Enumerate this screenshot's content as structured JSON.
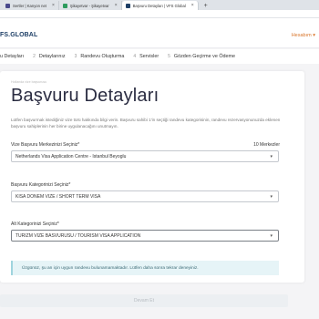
{
  "browser": {
    "tabs": [
      {
        "label": "Sertler | Kanyon net",
        "favicon_color": "#4a4a8c",
        "active": false
      },
      {
        "label": "Şikayetvar - Şikayetvar",
        "favicon_color": "#2e9b5e",
        "active": false
      },
      {
        "label": "Başvuru Detayları | VFS Global",
        "favicon_color": "#1e3f66",
        "active": true
      }
    ],
    "new_tab": "+"
  },
  "header": {
    "logo": "FS.GLOBAL",
    "user_menu": "Hesabım ▾"
  },
  "stepper": [
    {
      "num": "",
      "label": "u Detayları"
    },
    {
      "num": "2",
      "label": "Detaylarınız"
    },
    {
      "num": "3",
      "label": "Randevu Oluşturma"
    },
    {
      "num": "4",
      "label": "Servisler"
    },
    {
      "num": "5",
      "label": "Gözden Geçirme ve Ödeme"
    }
  ],
  "card": {
    "breadcrumb": "Hollanda vize başvurusu",
    "title": "Başvuru Detayları",
    "description": "Lütfen başvurmak istediğiniz vize türü hakkında bilgi verin. Başvuru sahibi 1'in seçtiği randevu kategorisinin, randevu rezervasyonunuzda eklenen başvuru sahiplerinin her birine uygulanacağını unutmayın.",
    "centre_label": "Vize Başvuru Merkezinizi Seçiniz*",
    "centre_count": "10 Merkezler",
    "centre_value": "Netherlands Visa Application Centre - Istanbul Beyoglu",
    "category_label": "Başvuru Kategorinizi Seçiniz*",
    "category_value": "KISA DONEM VIZE / SHORT TERM VISA",
    "subcategory_label": "Alt Kategorinizi Seçiniz*",
    "subcategory_value": "TURIZM VIZE BASVURUSU / TOURISM VISA APPLICATION",
    "alert": "Üzgünüz, şu an için uygun randevu bulunamamaktadır. Lütfen daha sonra tekrar deneyiniz."
  },
  "continue_label": "Devam Et"
}
